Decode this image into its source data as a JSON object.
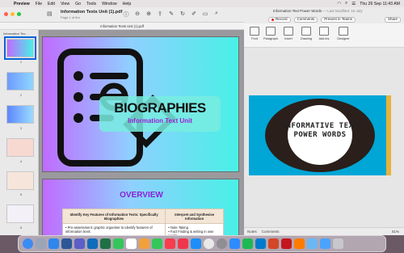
{
  "menubar": {
    "app_name": "Preview",
    "menus": [
      "File",
      "Edit",
      "View",
      "Go",
      "Tools",
      "Window",
      "Help"
    ],
    "clock": "Thu 26 Sep  11:43 AM"
  },
  "preview": {
    "title": "Information Texts Unit (1).pdf",
    "subtitle": "Page 1 of 6m",
    "file_label": "Information Texts Unit (1).pdf",
    "sidebar_doc_title": "Information Tex...",
    "thumb_numbers": [
      "1",
      "2",
      "3",
      "4",
      "5",
      "6"
    ],
    "slide1": {
      "headline": "BIOGRAPHIES",
      "subheadline": "Information Text Unit"
    },
    "slide2": {
      "headline": "OVERVIEW",
      "col1_header": "Identify Key Features of Information Texts: Specifically Biographies",
      "col2_header": "Interpret and Synthesise Information",
      "col1_row": "• Pre-assessment: graphic organiser to identify features of information texts",
      "col2_row": "• Note Taking\n• Fact Finding & writing in own words"
    }
  },
  "ppt": {
    "title": "Information Text Power Words",
    "title_suffix": " — Last Modified: 18 July",
    "buttons": {
      "record": "Record",
      "comments": "Comments",
      "present": "Present in Teams",
      "share": "Share"
    },
    "ribbon": [
      "Font",
      "Paragraph",
      "Insert",
      "Drawing",
      "Add-ins",
      "Designer"
    ],
    "slide_headline_line1": "INFORMATIVE TEXT",
    "slide_headline_line2": "POWER WORDS",
    "status": {
      "notes": "Notes",
      "comments": "Comments",
      "zoom": "51%"
    }
  },
  "dock": {
    "icons": [
      "finder-icon",
      "launchpad-icon",
      "safari-icon",
      "word-icon",
      "teams-icon",
      "outlook-icon",
      "excel-icon",
      "messages-icon",
      "calendar-icon",
      "photos-icon",
      "facetime-icon",
      "music-icon",
      "news-icon",
      "appstore-icon",
      "chrome-icon",
      "settings-icon",
      "zoom-icon",
      "spotify-icon",
      "vscode-icon",
      "powerpoint-icon",
      "acrobat-icon",
      "illustrator-icon",
      "preview-icon",
      "downloads-icon",
      "trash-icon"
    ],
    "colors": [
      "#3b8cf5",
      "#9aa5b8",
      "#2f86ee",
      "#2b5797",
      "#5b5fc7",
      "#0f6cbd",
      "#1e7145",
      "#33c759",
      "#ffffff",
      "#f2a13a",
      "#34c759",
      "#fa3c4c",
      "#f0364d",
      "#1c8ef9",
      "#e9e9e9",
      "#8e8e93",
      "#2d8cff",
      "#1db954",
      "#007acc",
      "#d24726",
      "#c4161c",
      "#ff7c00",
      "#6ab7f5",
      "#4aa3ff",
      "#c7c7cc"
    ]
  }
}
